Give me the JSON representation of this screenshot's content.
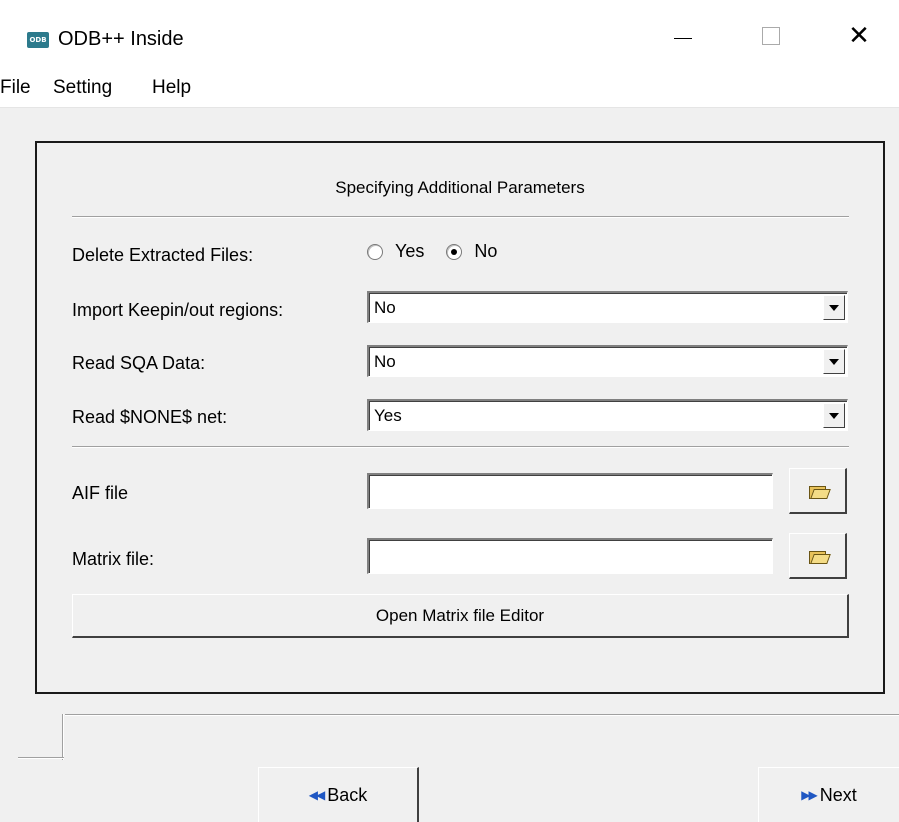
{
  "window": {
    "app_icon_text": "ODB",
    "title": "ODB++ Inside",
    "controls": {
      "minimize": "minimize",
      "maximize": "maximize",
      "close": "✕"
    }
  },
  "menu": [
    "File",
    "Setting",
    "Help"
  ],
  "panel": {
    "heading": "Specifying Additional Parameters",
    "delete_extracted": {
      "label": "Delete Extracted Files:",
      "options": [
        "Yes",
        "No"
      ],
      "selected": "No"
    },
    "import_keepin": {
      "label": "Import Keepin/out regions:",
      "value": "No"
    },
    "read_sqa": {
      "label": "Read SQA Data:",
      "value": "No"
    },
    "read_none_net": {
      "label": "Read $NONE$ net:",
      "value": "Yes"
    },
    "aif_file": {
      "label": "AIF file",
      "value": ""
    },
    "matrix_file": {
      "label": "Matrix file:",
      "value": ""
    },
    "open_editor_label": "Open Matrix file Editor"
  },
  "nav": {
    "back_icon": "◀◀",
    "back_label": "Back",
    "next_icon": "▶▶",
    "next_label": "Next"
  },
  "icons": {
    "browse": "folder-open-icon"
  }
}
